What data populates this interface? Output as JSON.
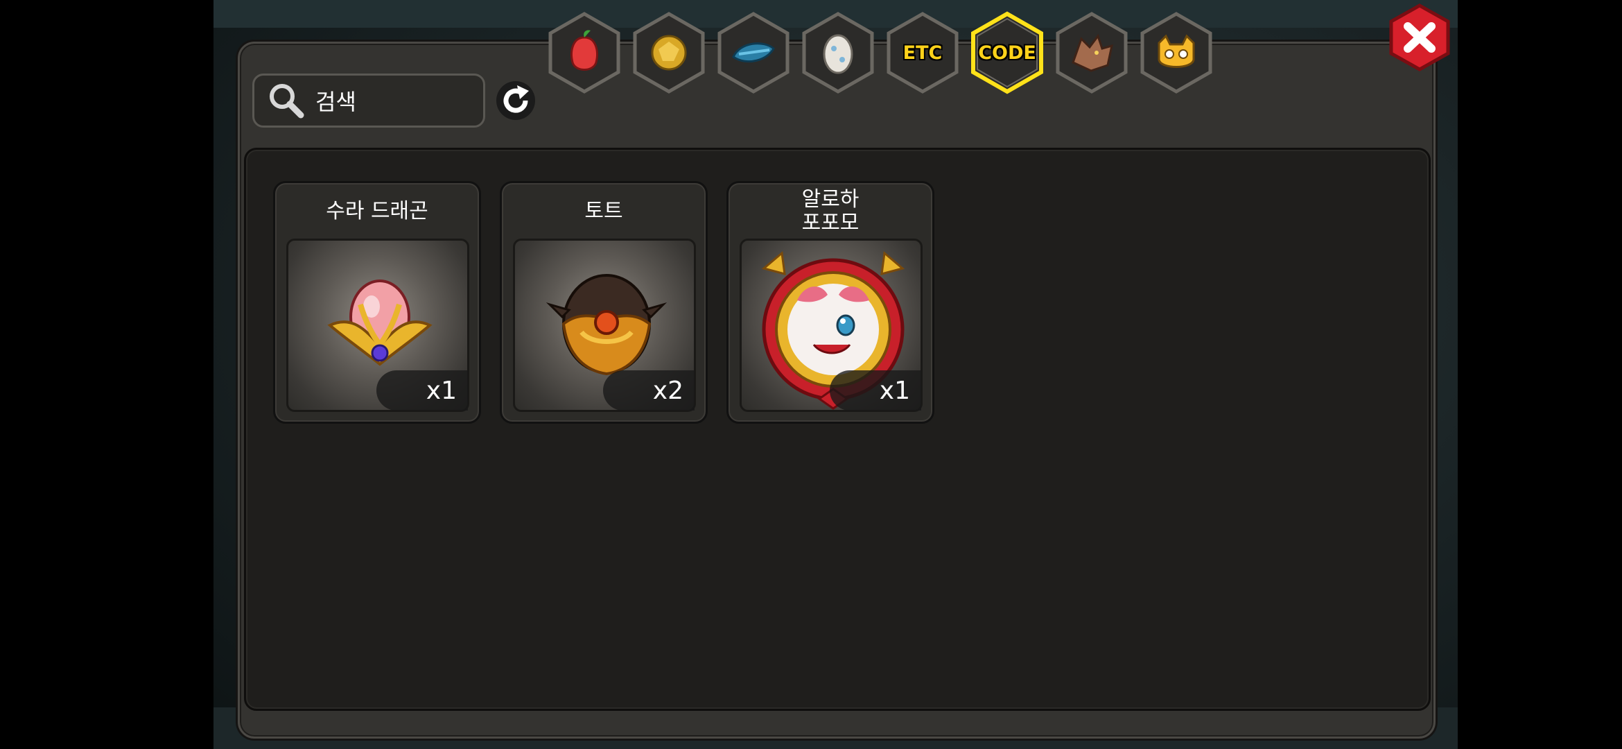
{
  "search": {
    "placeholder": "검색",
    "icon": "magnifier-icon"
  },
  "refresh": {
    "icon": "refresh-icon"
  },
  "tabs": [
    {
      "icon": "fruit-icon",
      "label": ""
    },
    {
      "icon": "gold-ore-icon",
      "label": ""
    },
    {
      "icon": "blue-fish-icon",
      "label": ""
    },
    {
      "icon": "egg-icon",
      "label": ""
    },
    {
      "icon": "etc-icon",
      "label": "ETC"
    },
    {
      "icon": "code-icon",
      "label": "CODE",
      "selected": true
    },
    {
      "icon": "dragon-head-icon",
      "label": ""
    },
    {
      "icon": "monster-face-icon",
      "label": ""
    }
  ],
  "items": [
    {
      "name": "수라 드래곤",
      "quantity": "x1",
      "icon": "red-gold-egg-icon"
    },
    {
      "name": "토트",
      "quantity": "x2",
      "icon": "dark-gold-egg-icon"
    },
    {
      "name": "알로하\n포포모",
      "quantity": "x1",
      "icon": "popomo-portrait-icon"
    }
  ],
  "colors": {
    "accent": "#ffd21a",
    "close": "#d8202b",
    "panel": "#343330"
  }
}
